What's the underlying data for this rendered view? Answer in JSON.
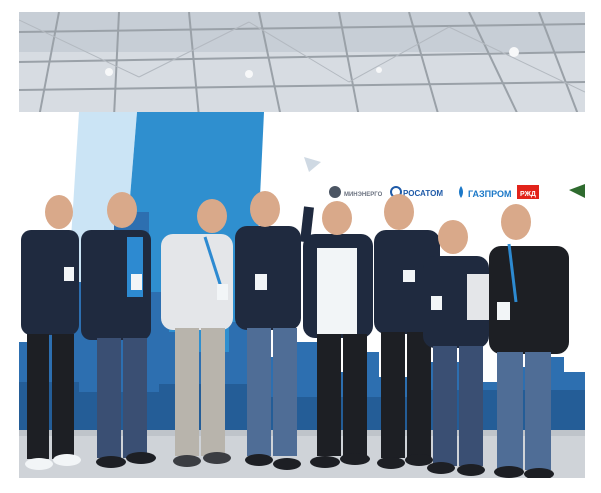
{
  "photo": {
    "subject": "group-photo-at-exhibition",
    "colors": {
      "ceiling": "#d7dce2",
      "truss": "#9aa1a8",
      "backdrop": "#ffffff",
      "blue_accent": "#2f8fcf",
      "skyline_blue": "#2d6fb0",
      "floor": "#cfd3d8",
      "vest_navy": "#1f2a3f",
      "jeans": "#3a4f73",
      "jacket_black": "#1d1f24",
      "skin": "#d9a98a",
      "badge": "#f2f5f7",
      "lanyard": "#2d8ad1"
    },
    "sponsor_logos": [
      {
        "icon": "ministry-emblem",
        "text": "",
        "color": "#4b5563"
      },
      {
        "icon": "rosatom-logo",
        "text": "РОСАТОМ",
        "color": "#1e5aa8"
      },
      {
        "icon": "gazprom-logo",
        "text": "ГАЗПРОМ",
        "color": "#1b78c8"
      },
      {
        "icon": "rzd-logo",
        "text": "РЖД",
        "color": "#e2231a"
      }
    ]
  }
}
